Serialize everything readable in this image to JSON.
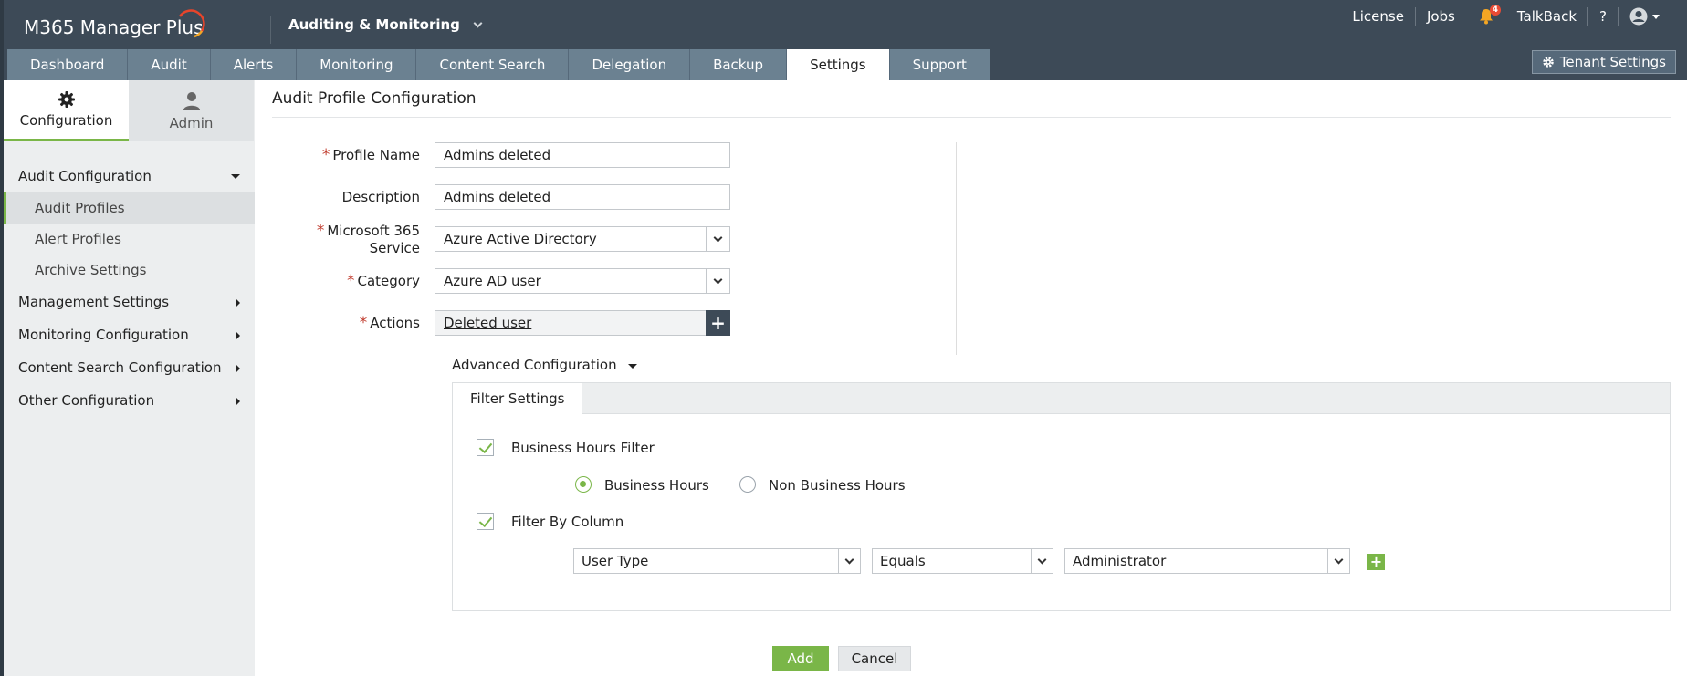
{
  "header": {
    "logo_text": "M365 Manager Plus",
    "module": "Auditing & Monitoring",
    "links": [
      "License",
      "Jobs",
      "TalkBack",
      "?"
    ],
    "notification_count": "4",
    "tenant_settings_label": "Tenant Settings"
  },
  "nav_tabs": [
    "Dashboard",
    "Audit",
    "Alerts",
    "Monitoring",
    "Content Search",
    "Delegation",
    "Backup",
    "Settings",
    "Support"
  ],
  "sidebar": {
    "tabs": [
      "Configuration",
      "Admin"
    ],
    "groups": [
      {
        "label": "Audit Configuration",
        "items": [
          "Audit Profiles",
          "Alert Profiles",
          "Archive Settings"
        ]
      },
      {
        "label": "Management Settings"
      },
      {
        "label": "Monitoring Configuration"
      },
      {
        "label": "Content Search Configuration"
      },
      {
        "label": "Other Configuration"
      }
    ]
  },
  "main": {
    "title": "Audit Profile Configuration",
    "form": {
      "profile_name_label": "Profile Name",
      "profile_name_value": "Admins deleted",
      "description_label": "Description",
      "description_value": "Admins deleted",
      "service_label": "Microsoft 365 Service",
      "service_value": "Azure Active Directory",
      "category_label": "Category",
      "category_value": "Azure AD user",
      "actions_label": "Actions",
      "actions_value": "Deleted user",
      "required_mark": "*"
    },
    "advanced": {
      "title": "Advanced Configuration",
      "tab": "Filter Settings",
      "business_hours_filter": "Business Hours Filter",
      "business_hours": "Business Hours",
      "non_business_hours": "Non Business Hours",
      "filter_by_column": "Filter By Column",
      "column_value": "User Type",
      "operator_value": "Equals",
      "match_value": "Administrator"
    },
    "add_label": "Add",
    "cancel_label": "Cancel"
  },
  "colors": {
    "topbar": "#3d4a57",
    "tab_bar": "#6b8191",
    "accent_green": "#7ab648",
    "required_red": "#c0392b",
    "notification_orange": "#f5a623"
  }
}
